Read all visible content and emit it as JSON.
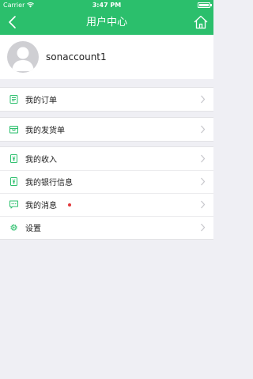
{
  "status_bar": {
    "carrier": "Carrier",
    "time": "3:47 PM"
  },
  "nav": {
    "title": "用户中心"
  },
  "profile": {
    "username": "sonaccount1"
  },
  "menu": {
    "orders": "我的订单",
    "shipments": "我的发货单",
    "income": "我的收入",
    "bank_info": "我的银行信息",
    "messages": "我的消息",
    "settings": "设置"
  },
  "colors": {
    "accent": "#2bbf6c",
    "badge": "#e2383b",
    "background": "#efeff4"
  }
}
